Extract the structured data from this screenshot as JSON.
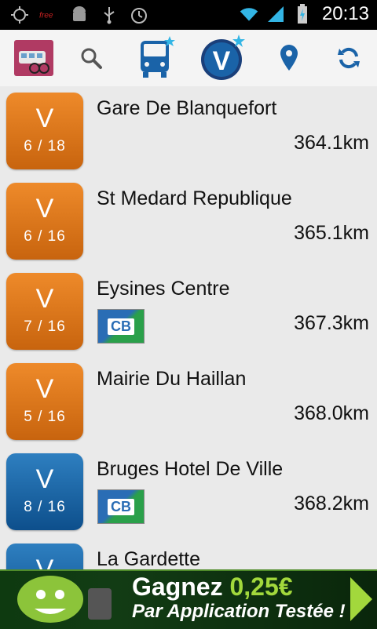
{
  "status_bar": {
    "time": "20:13",
    "icons": [
      "gps-icon",
      "carrier-logo-icon",
      "android-debug-icon",
      "usb-icon",
      "alarm-icon",
      "wifi-icon",
      "signal-icon",
      "battery-charging-icon"
    ]
  },
  "toolbar": {
    "buttons": [
      "app-logo-icon",
      "search-icon",
      "bus-favorites-icon",
      "vcub-favorites-icon",
      "location-icon",
      "refresh-icon"
    ]
  },
  "stations": [
    {
      "letter": "V",
      "count": "6 / 18",
      "name": "Gare De Blanquefort",
      "distance": "364.1km",
      "color": "orange",
      "card": false
    },
    {
      "letter": "V",
      "count": "6 / 16",
      "name": "St Medard Republique",
      "distance": "365.1km",
      "color": "orange",
      "card": false
    },
    {
      "letter": "V",
      "count": "7 / 16",
      "name": "Eysines Centre",
      "distance": "367.3km",
      "color": "orange",
      "card": true
    },
    {
      "letter": "V",
      "count": "5 / 16",
      "name": "Mairie Du Haillan",
      "distance": "368.0km",
      "color": "orange",
      "card": false
    },
    {
      "letter": "V",
      "count": "8 / 16",
      "name": "Bruges Hotel De Ville",
      "distance": "368.2km",
      "color": "blue",
      "card": true
    },
    {
      "letter": "V",
      "count": "",
      "name": "La Gardette",
      "distance": "",
      "color": "blue",
      "card": false
    }
  ],
  "card_label": "CB",
  "ad": {
    "line1_prefix": "Gagnez ",
    "line1_highlight": "0,25€",
    "line2": "Par Application Testée !"
  },
  "colors": {
    "orange": "#e07b1d",
    "blue": "#1a63a8",
    "ad_green": "#a2d83c"
  }
}
